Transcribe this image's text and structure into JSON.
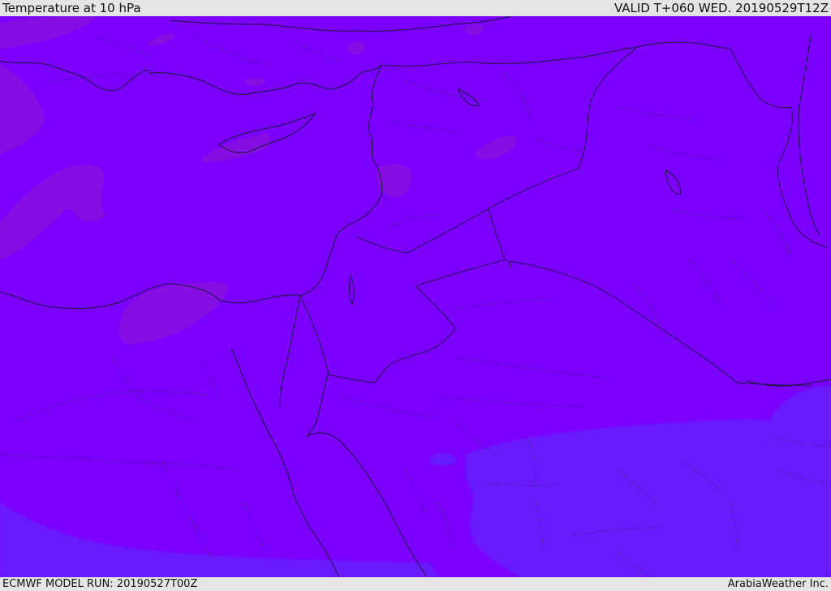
{
  "header": {
    "title": "Temperature at 10 hPa",
    "valid": "VALID T+060 WED. 20190529T12Z"
  },
  "footer": {
    "model_run": "ECMWF MODEL RUN: 20190527T00Z",
    "credit": "ArabiaWeather Inc."
  },
  "colors": {
    "base": "#7b00fe",
    "warm_patch": "#8a10de",
    "cool_patch": "#6a1afe",
    "cool_patch_edge": "#7010fe",
    "lines": "#1a1a40"
  },
  "map": {
    "field": "temperature",
    "level": "10 hPa"
  }
}
